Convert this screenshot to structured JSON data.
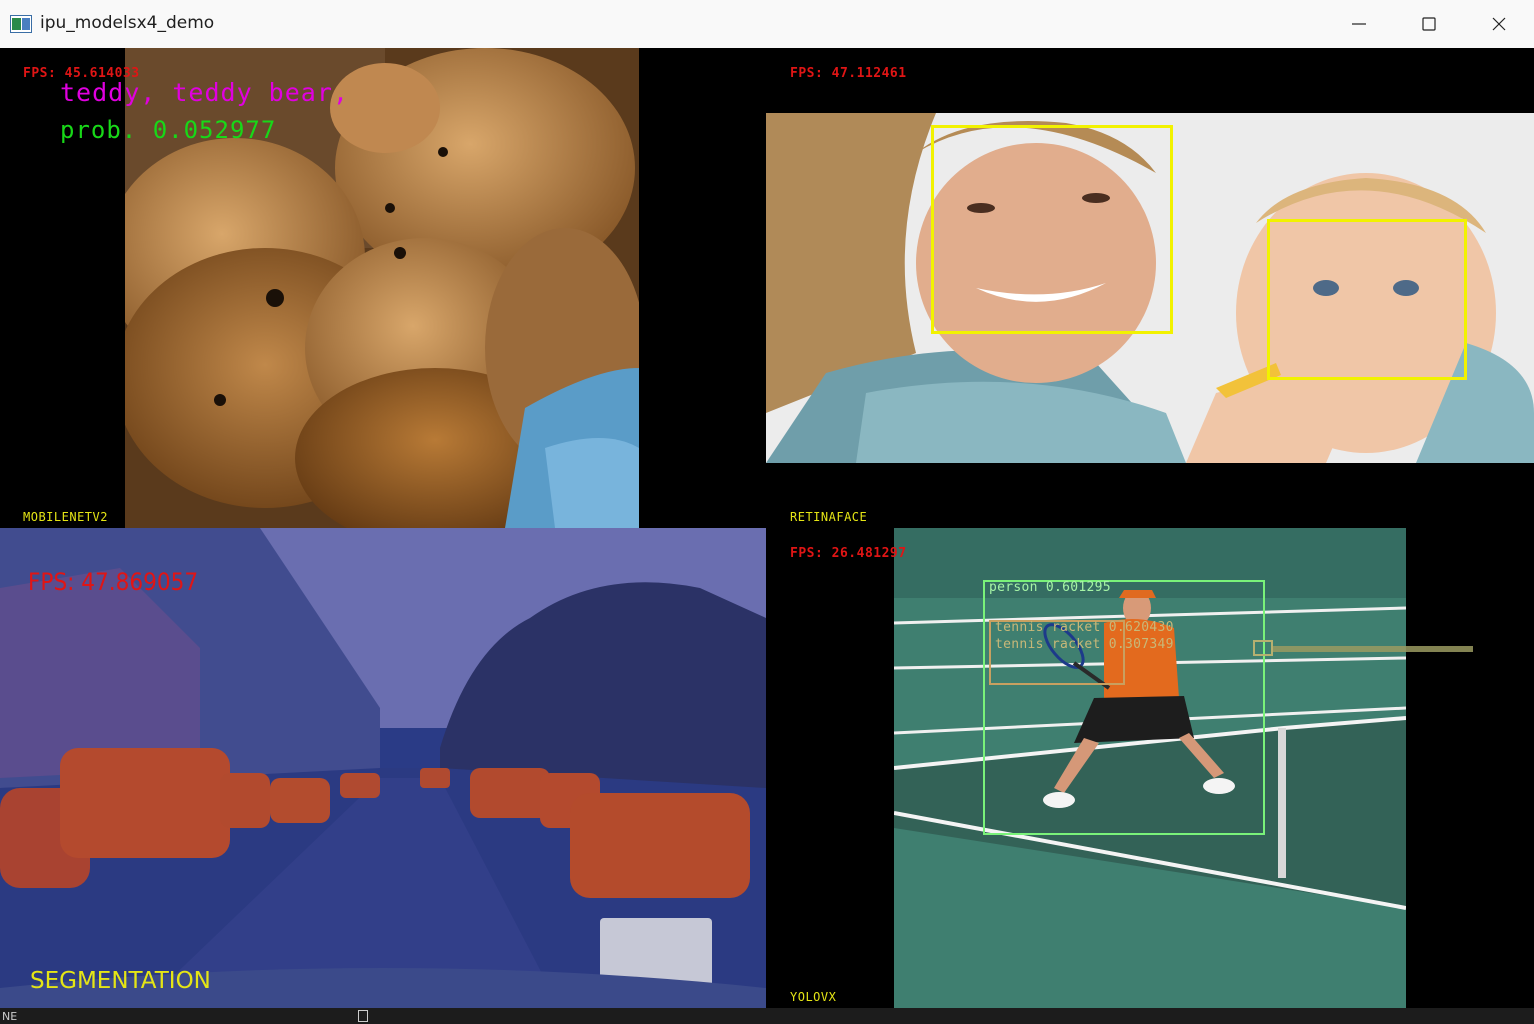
{
  "window": {
    "title": "ipu_modelsx4_demo",
    "controls": [
      "minimize",
      "maximize",
      "close"
    ]
  },
  "panes": {
    "classification": {
      "fps": "FPS: 45.614033",
      "class_label": "teddy, teddy bear,",
      "prob_label": "prob. 0.052977",
      "model_name": "MOBILENETV2"
    },
    "face_detection": {
      "fps": "FPS: 47.112461",
      "model_name": "RETINAFACE",
      "detections": 2
    },
    "segmentation": {
      "fps": "FPS: 47.869057",
      "model_name": "SEGMENTATION"
    },
    "object_detection": {
      "fps": "FPS: 26.481297",
      "model_name": "YOLOVX",
      "detections": [
        {
          "label": "person 0.601295"
        },
        {
          "label": "tennis racket 0.620430"
        },
        {
          "label": "tennis racket 0.307349"
        }
      ]
    }
  },
  "taskbar": {
    "left_text": "NE"
  },
  "colors": {
    "fps": "#e01515",
    "model_label": "#e5e515",
    "class_label": "#e000e0",
    "prob_label": "#18d818",
    "face_box": "#f2f200",
    "person_box": "#7af27a",
    "racket_box": "#c8a060"
  }
}
